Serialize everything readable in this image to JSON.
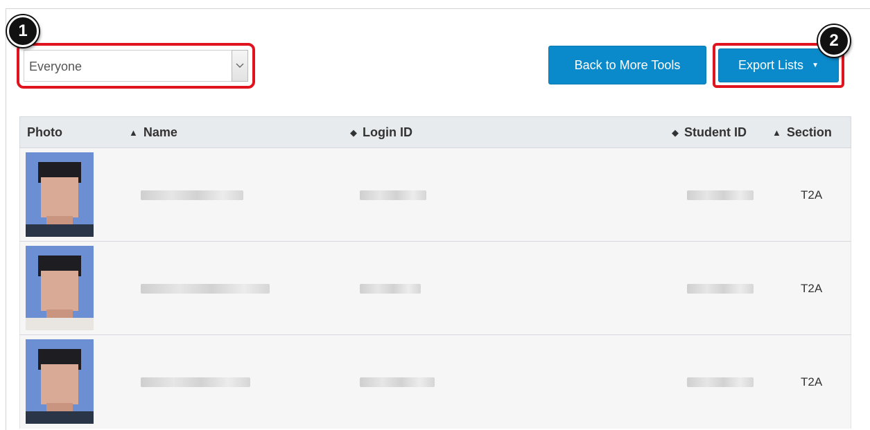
{
  "filter": {
    "selected": "Everyone"
  },
  "callouts": [
    "1",
    "2"
  ],
  "buttons": {
    "back_label": "Back to More Tools",
    "export_label": "Export Lists",
    "export_caret": "▼"
  },
  "table": {
    "headers": {
      "photo": "Photo",
      "name": "Name",
      "login_id": "Login ID",
      "student_id": "Student ID",
      "section": "Section"
    },
    "sort_icons": {
      "name": "▲",
      "login_id": "◆",
      "student_id": "◆",
      "section": "▲"
    },
    "rows": [
      {
        "section": "T2A"
      },
      {
        "section": "T2A"
      },
      {
        "section": "T2A"
      }
    ]
  },
  "colors": {
    "primary_button": "#0a8acb",
    "highlight": "#e0141e",
    "header_bg": "#e8ebee"
  }
}
